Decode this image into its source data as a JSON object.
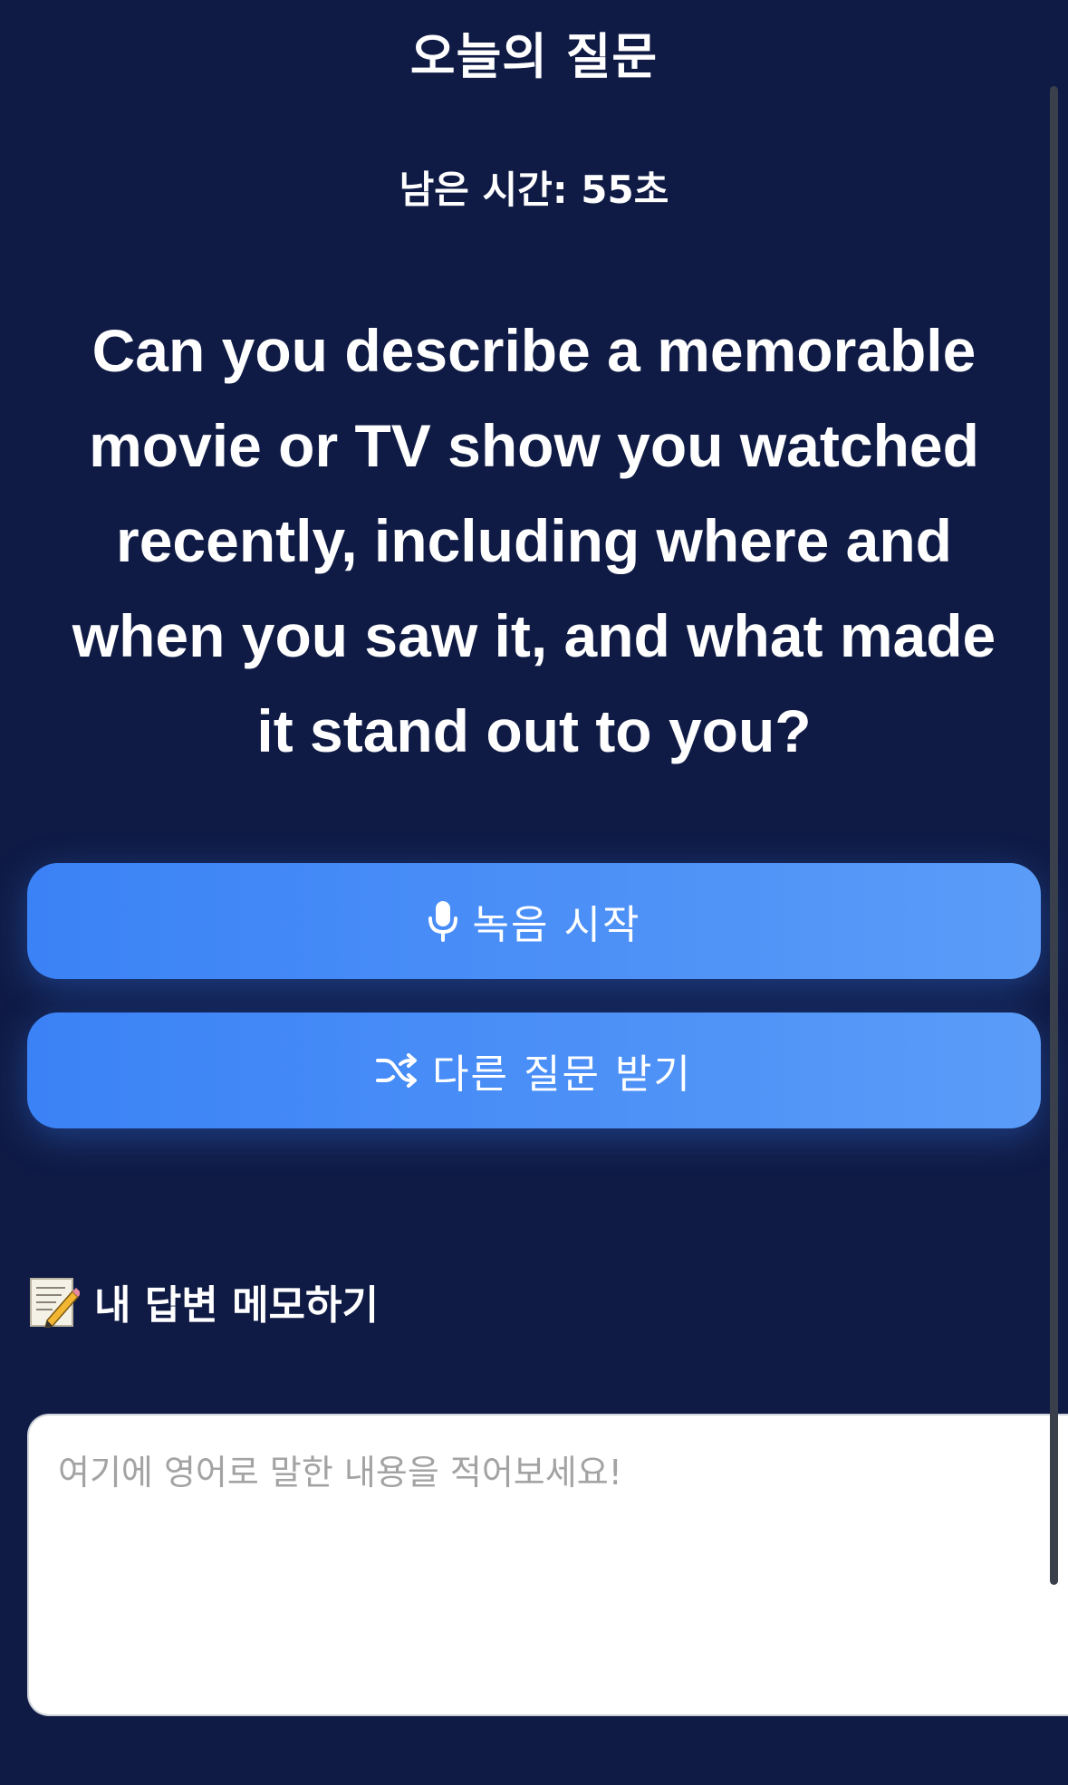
{
  "header": {
    "title": "오늘의 질문",
    "timer_text": "남은 시간: 55초"
  },
  "question": {
    "text": "Can you describe a memorable movie or TV show you watched recently, including where and when you saw it, and what made it stand out to you?"
  },
  "buttons": {
    "record": {
      "label": "녹음 시작",
      "icon": "microphone-icon"
    },
    "new_question": {
      "label": "다른 질문 받기",
      "icon": "shuffle-icon"
    }
  },
  "memo": {
    "heading": "내 답변 메모하기",
    "icon": "memo-icon",
    "placeholder": "여기에 영어로 말한 내용을 적어보세요!",
    "value": ""
  },
  "colors": {
    "background": "#0f1b45",
    "button_start": "#3b82f6",
    "button_end": "#5a9cf8"
  }
}
